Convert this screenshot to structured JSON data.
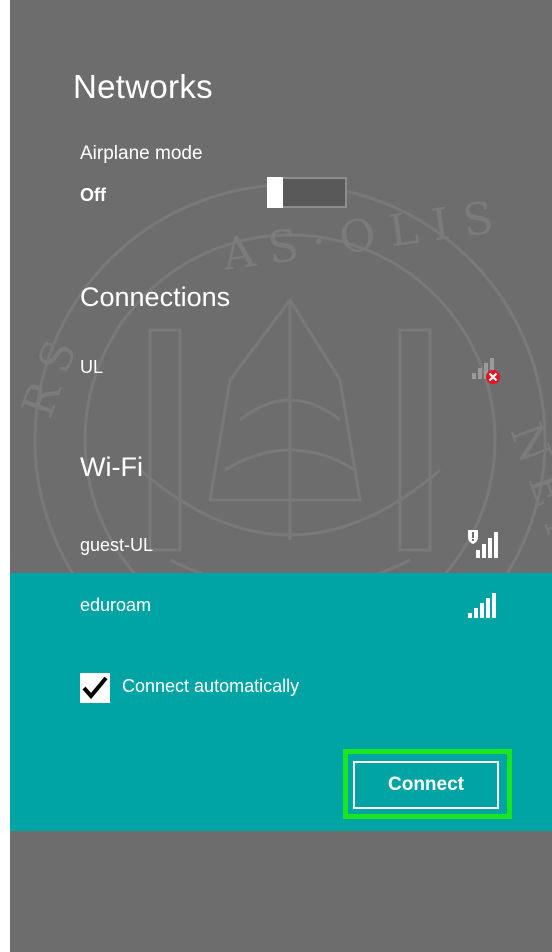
{
  "panel": {
    "title": "Networks",
    "background_color": "#6d6d6d",
    "accent_color": "#00a4a5",
    "highlight_color": "#19e61e"
  },
  "airplane_mode": {
    "label": "Airplane mode",
    "state": "Off",
    "enabled": false
  },
  "connections": {
    "heading": "Connections",
    "items": [
      {
        "name": "UL",
        "icon": "cellular-signal-disconnected-icon"
      }
    ]
  },
  "wifi": {
    "heading": "Wi-Fi",
    "networks": [
      {
        "name": "guest-UL",
        "icon": "wifi-signal-secured-warning-icon",
        "secured": false
      },
      {
        "name": "eduroam",
        "icon": "wifi-signal-icon",
        "selected": true
      }
    ]
  },
  "selected_network": {
    "connect_automatically_label": "Connect automatically",
    "connect_automatically_checked": true,
    "connect_button_label": "Connect"
  }
}
